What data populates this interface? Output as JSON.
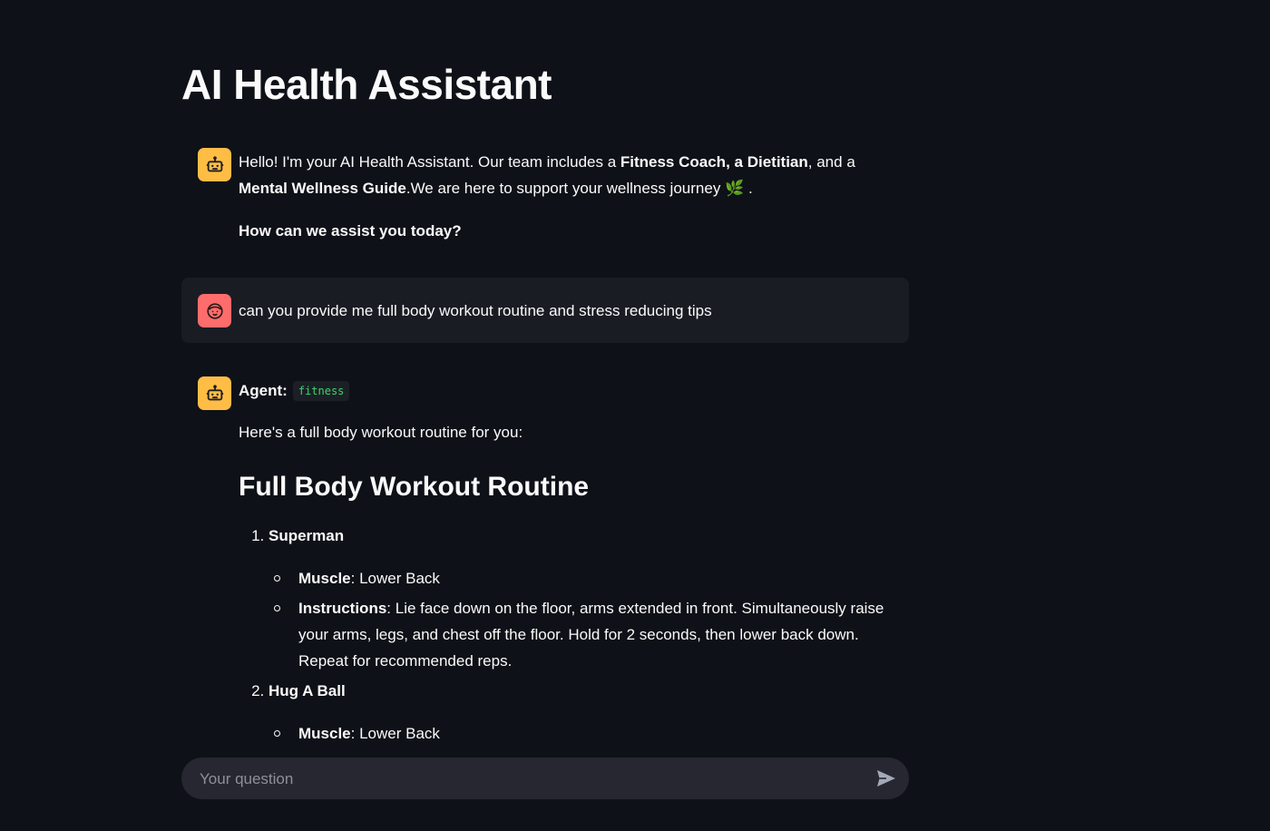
{
  "page": {
    "title": "AI Health Assistant"
  },
  "messages": {
    "welcome": {
      "avatar": "robot-icon",
      "t1": "Hello! I'm your AI Health Assistant. Our team includes a ",
      "b1": "Fitness Coach",
      "t2": ", ",
      "b2": "a Dietitian",
      "t3": ", and a ",
      "b3": "Mental Wellness Guide",
      "t4": ".We are here to support your wellness journey ",
      "emoji": "🌿",
      "t5": " .",
      "question": "How can we assist you today?"
    },
    "user": {
      "avatar": "face-icon",
      "text": "can you provide me full body workout routine and stress reducing tips"
    },
    "agent": {
      "avatar": "robot-icon",
      "label": "Agent:",
      "badge": "fitness",
      "intro": "Here's a full body workout routine for you:",
      "heading": "Full Body Workout Routine",
      "items": [
        {
          "title": "Superman",
          "muscle_label": "Muscle",
          "muscle": ": Lower Back",
          "instructions_label": "Instructions",
          "instructions": ": Lie face down on the floor, arms extended in front. Simultaneously raise your arms, legs, and chest off the floor. Hold for 2 seconds, then lower back down. Repeat for recommended reps."
        },
        {
          "title": "Hug A Ball",
          "muscle_label": "Muscle",
          "muscle": ": Lower Back"
        }
      ]
    }
  },
  "input": {
    "placeholder": "Your question",
    "send_icon": "send-icon"
  },
  "colors": {
    "background": "#0e1117",
    "bot_avatar": "#ffbd45",
    "user_avatar": "#ff6c6c",
    "badge_text": "#3dd56d"
  }
}
